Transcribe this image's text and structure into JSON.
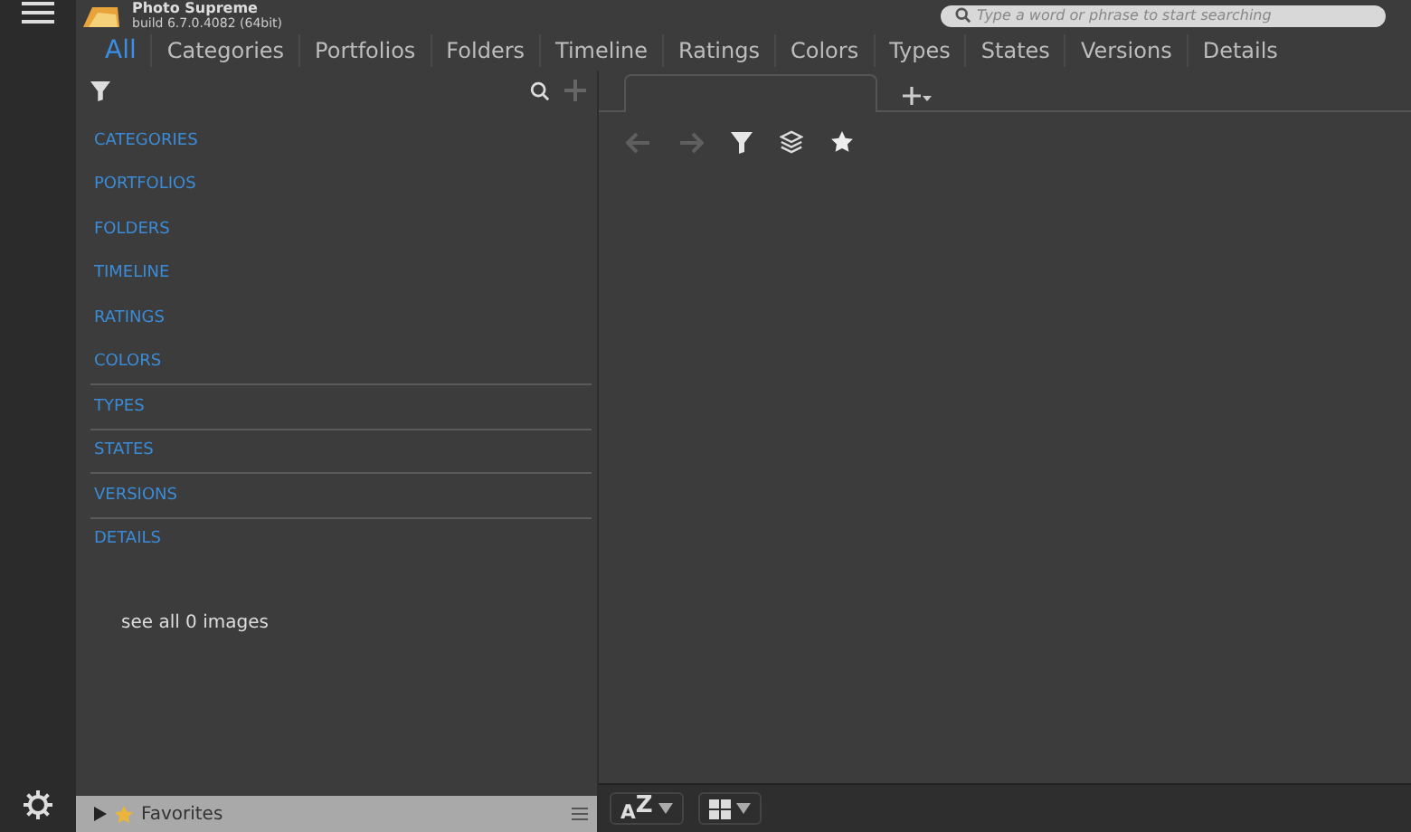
{
  "app": {
    "title": "Photo Supreme",
    "build": "build 6.7.0.4082 (64bit)"
  },
  "search": {
    "placeholder": "Type a word or phrase to start searching"
  },
  "tabs": [
    {
      "label": "All",
      "selected": true
    },
    {
      "label": "Categories",
      "selected": false
    },
    {
      "label": "Portfolios",
      "selected": false
    },
    {
      "label": "Folders",
      "selected": false
    },
    {
      "label": "Timeline",
      "selected": false
    },
    {
      "label": "Ratings",
      "selected": false
    },
    {
      "label": "Colors",
      "selected": false
    },
    {
      "label": "Types",
      "selected": false
    },
    {
      "label": "States",
      "selected": false
    },
    {
      "label": "Versions",
      "selected": false
    },
    {
      "label": "Details",
      "selected": false
    }
  ],
  "sections": [
    {
      "label": "CATEGORIES",
      "rule": false
    },
    {
      "label": "PORTFOLIOS",
      "rule": false
    },
    {
      "label": "FOLDERS",
      "rule": false
    },
    {
      "label": "TIMELINE",
      "rule": false
    },
    {
      "label": "RATINGS",
      "rule": false
    },
    {
      "label": "COLORS",
      "rule": true
    },
    {
      "label": "TYPES",
      "rule": true
    },
    {
      "label": "STATES",
      "rule": true
    },
    {
      "label": "VERSIONS",
      "rule": true
    },
    {
      "label": "DETAILS",
      "rule": false
    }
  ],
  "see_all": "see all 0 images",
  "favorites": {
    "label": "Favorites",
    "expanded": false
  },
  "nav": {
    "back_disabled": true,
    "forward_disabled": true
  },
  "sort_label": "$_{A}$Z"
}
